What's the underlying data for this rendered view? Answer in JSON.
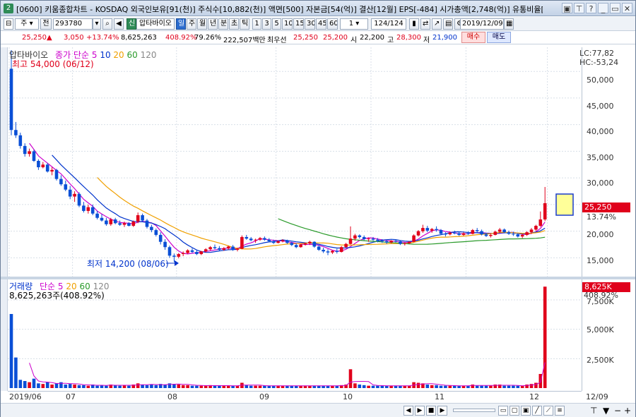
{
  "window": {
    "number": "2",
    "title": "[0600] 키움종합차트 - KOSDAQ 외국인보유[91(천)] 주식수[10,882(천)] 액면[500] 자본금[54(억)] 결산[12월] EPS[-484] 시가총액[2,748(억)] 유통비율[64.8"
  },
  "toolbar": {
    "type_select": "주",
    "tab_jeon": "전",
    "code": "293780",
    "shin": "신",
    "stock_name": "압타바이오",
    "periods": [
      "일",
      "주",
      "월",
      "년",
      "분",
      "초",
      "틱"
    ],
    "minutes": [
      "1",
      "3",
      "5",
      "10",
      "15",
      "30",
      "45",
      "60"
    ],
    "count_select": "1",
    "page_count": "124/124",
    "date": "2019/12/09",
    "sell_label": "매수",
    "buy_label": "매도"
  },
  "quote": {
    "price": "25,250",
    "change": "3,050",
    "change_pct": "+13.74%",
    "volume": "8,625,263",
    "vol_ratio": "408.92%",
    "turnover_pct": "79.26%",
    "amount": "222,507백만",
    "best_label": "최우선",
    "ask": "25,250",
    "bid": "25,200",
    "open_label": "시",
    "open": "22,200",
    "high_label": "고",
    "high": "28,300",
    "low_label": "저",
    "low": "21,900"
  },
  "price_panel": {
    "stock_name": "압타바이오",
    "ma_label": "종가 단순",
    "ma_periods": [
      "5",
      "10",
      "20",
      "60",
      "120"
    ],
    "ma_colors": [
      "#cc00cc",
      "#0033cc",
      "#f0a000",
      "#2a9a2a",
      "#888888"
    ],
    "high_note": "최고 54,000 (06/12)",
    "low_note": "최저 14,200 (08/06)",
    "lc": "LC:77,82",
    "hc": "HC:-53,24",
    "current_price": "25,250",
    "current_pct": "13.74%",
    "yticks": [
      "50,000",
      "45,000",
      "40,000",
      "35,000",
      "30,000",
      "25,000",
      "20,000",
      "15,000"
    ]
  },
  "volume_panel": {
    "title": "거래량",
    "ma_label": "단순",
    "ma_periods": [
      "5",
      "20",
      "60",
      "120"
    ],
    "value_note": "8,625,263주(408.92%)",
    "current": "8,625K",
    "current_pct": "408.92%",
    "yticks": [
      "7,500K",
      "5,000K",
      "2,500K"
    ]
  },
  "xaxis": {
    "labels": [
      "2019/06",
      "07",
      "08",
      "09",
      "10",
      "11",
      "12",
      "12/09"
    ]
  },
  "chart_data": {
    "type": "candlestick",
    "price_ylim": [
      12000,
      54000
    ],
    "volume_ylim": [
      0,
      9000
    ],
    "candles": [
      [
        50500,
        54000,
        38000,
        39000
      ],
      [
        39000,
        40500,
        37500,
        38000
      ],
      [
        38000,
        38500,
        35500,
        36000
      ],
      [
        36000,
        36500,
        34000,
        34500
      ],
      [
        34500,
        35500,
        34000,
        35000
      ],
      [
        35000,
        35300,
        33000,
        33200
      ],
      [
        33200,
        33500,
        31500,
        32000
      ],
      [
        32000,
        33000,
        31800,
        32500
      ],
      [
        32500,
        32800,
        31000,
        31200
      ],
      [
        31200,
        32000,
        30500,
        31500
      ],
      [
        31500,
        31700,
        29500,
        29800
      ],
      [
        29800,
        30500,
        28500,
        28800
      ],
      [
        28800,
        29500,
        27500,
        27800
      ],
      [
        27800,
        28500,
        26000,
        26500
      ],
      [
        26500,
        27500,
        25500,
        27000
      ],
      [
        27000,
        27300,
        24500,
        24800
      ],
      [
        24800,
        25500,
        23500,
        23800
      ],
      [
        23800,
        25000,
        23300,
        24500
      ],
      [
        24500,
        25000,
        23000,
        23300
      ],
      [
        23300,
        23800,
        22200,
        22500
      ],
      [
        22500,
        23200,
        21800,
        22000
      ],
      [
        22000,
        22500,
        21000,
        21300
      ],
      [
        21300,
        22500,
        21000,
        22200
      ],
      [
        22200,
        22500,
        21300,
        21500
      ],
      [
        21500,
        22000,
        21000,
        21200
      ],
      [
        21200,
        21800,
        20800,
        21500
      ],
      [
        21500,
        21700,
        20900,
        21000
      ],
      [
        21000,
        22000,
        20800,
        21800
      ],
      [
        21800,
        23500,
        21500,
        23000
      ],
      [
        23000,
        23300,
        21800,
        22000
      ],
      [
        22000,
        22300,
        20500,
        20800
      ],
      [
        20800,
        21200,
        19800,
        20200
      ],
      [
        20200,
        20500,
        19000,
        19300
      ],
      [
        19300,
        19800,
        17500,
        18000
      ],
      [
        18000,
        18500,
        16500,
        17000
      ],
      [
        17000,
        17300,
        15000,
        15400
      ],
      [
        15400,
        15800,
        14200,
        15200
      ],
      [
        15200,
        15900,
        14900,
        15700
      ],
      [
        15700,
        16200,
        15300,
        15900
      ],
      [
        15900,
        16600,
        15700,
        16400
      ],
      [
        16400,
        16800,
        15900,
        16100
      ],
      [
        16100,
        16500,
        15500,
        15700
      ],
      [
        15700,
        16300,
        15500,
        16200
      ],
      [
        16200,
        16800,
        16000,
        16600
      ],
      [
        16600,
        17200,
        16400,
        17000
      ],
      [
        17000,
        17500,
        16600,
        16800
      ],
      [
        16800,
        17200,
        16300,
        16500
      ],
      [
        16500,
        17000,
        16300,
        16800
      ],
      [
        16800,
        17300,
        16500,
        17100
      ],
      [
        17100,
        17400,
        16300,
        16500
      ],
      [
        16500,
        16900,
        16200,
        16700
      ],
      [
        16700,
        19200,
        16600,
        18900
      ],
      [
        18900,
        19300,
        18400,
        18600
      ],
      [
        18600,
        18900,
        18100,
        18300
      ],
      [
        18300,
        18600,
        17800,
        18400
      ],
      [
        18400,
        18900,
        18200,
        18700
      ],
      [
        18700,
        19000,
        18200,
        18400
      ],
      [
        18400,
        18700,
        17900,
        18100
      ],
      [
        18100,
        18400,
        17600,
        17800
      ],
      [
        17800,
        18300,
        17700,
        18100
      ],
      [
        18100,
        18500,
        17900,
        18300
      ],
      [
        18300,
        18400,
        17600,
        17800
      ],
      [
        17800,
        18000,
        17200,
        17400
      ],
      [
        17400,
        17700,
        16800,
        17000
      ],
      [
        17000,
        17600,
        16900,
        17500
      ],
      [
        17500,
        17900,
        17300,
        17700
      ],
      [
        17700,
        18200,
        17400,
        18000
      ],
      [
        18000,
        18100,
        16900,
        17100
      ],
      [
        17100,
        17400,
        16300,
        16500
      ],
      [
        16500,
        16900,
        15900,
        16200
      ],
      [
        16200,
        16600,
        15500,
        16000
      ],
      [
        16000,
        16400,
        15700,
        16300
      ],
      [
        16300,
        16700,
        15800,
        16100
      ],
      [
        16100,
        17200,
        16000,
        17000
      ],
      [
        17000,
        17800,
        16900,
        17600
      ],
      [
        17600,
        20900,
        17500,
        18600
      ],
      [
        18600,
        19500,
        18200,
        19200
      ],
      [
        19200,
        19400,
        18600,
        18900
      ],
      [
        18900,
        19200,
        18300,
        18500
      ],
      [
        18500,
        18800,
        18000,
        18600
      ],
      [
        18600,
        18900,
        18200,
        18400
      ],
      [
        18400,
        18700,
        17900,
        18200
      ],
      [
        18200,
        18500,
        17800,
        18100
      ],
      [
        18100,
        18400,
        17600,
        17900
      ],
      [
        17900,
        18300,
        17700,
        18200
      ],
      [
        18200,
        18500,
        17900,
        18100
      ],
      [
        18100,
        18200,
        17400,
        17600
      ],
      [
        17600,
        17900,
        17300,
        17700
      ],
      [
        17700,
        18100,
        17600,
        18000
      ],
      [
        18000,
        19400,
        17900,
        19200
      ],
      [
        19200,
        20200,
        19000,
        20000
      ],
      [
        20000,
        21200,
        19700,
        20600
      ],
      [
        20600,
        21000,
        19800,
        20100
      ],
      [
        20100,
        20600,
        19700,
        20400
      ],
      [
        20400,
        20900,
        19900,
        20200
      ],
      [
        20200,
        20400,
        19300,
        19500
      ],
      [
        19500,
        19800,
        19000,
        19400
      ],
      [
        19400,
        19900,
        19200,
        19700
      ],
      [
        19700,
        20100,
        19400,
        19600
      ],
      [
        19600,
        19900,
        19100,
        19300
      ],
      [
        19300,
        19800,
        19100,
        19600
      ],
      [
        19600,
        20000,
        19300,
        19500
      ],
      [
        19500,
        20400,
        19400,
        20200
      ],
      [
        20200,
        20600,
        19800,
        20000
      ],
      [
        20000,
        20300,
        19200,
        19400
      ],
      [
        19400,
        19700,
        18900,
        19100
      ],
      [
        19100,
        19500,
        18800,
        19300
      ],
      [
        19300,
        20100,
        19200,
        19900
      ],
      [
        19900,
        20600,
        19700,
        20300
      ],
      [
        20300,
        20500,
        19600,
        19800
      ],
      [
        19800,
        20100,
        19300,
        19500
      ],
      [
        19500,
        19900,
        19100,
        19400
      ],
      [
        19400,
        19600,
        18800,
        19000
      ],
      [
        19000,
        19500,
        18700,
        19300
      ],
      [
        19300,
        20000,
        19100,
        19800
      ],
      [
        19800,
        20600,
        19500,
        20300
      ],
      [
        20300,
        21200,
        20000,
        21000
      ],
      [
        21000,
        23700,
        20800,
        22200
      ],
      [
        22200,
        28300,
        21900,
        25250
      ]
    ],
    "volumes": [
      6300,
      2600,
      700,
      600,
      500,
      800,
      400,
      350,
      500,
      300,
      400,
      500,
      300,
      350,
      300,
      250,
      250,
      200,
      300,
      200,
      250,
      200,
      300,
      250,
      200,
      250,
      200,
      300,
      400,
      300,
      250,
      300,
      250,
      350,
      300,
      400,
      350,
      300,
      250,
      250,
      200,
      200,
      200,
      200,
      250,
      200,
      200,
      200,
      200,
      200,
      200,
      450,
      250,
      200,
      200,
      200,
      200,
      200,
      200,
      200,
      200,
      200,
      200,
      200,
      200,
      200,
      200,
      200,
      200,
      200,
      200,
      200,
      200,
      250,
      300,
      1600,
      400,
      300,
      250,
      200,
      200,
      200,
      200,
      200,
      200,
      200,
      200,
      200,
      200,
      500,
      450,
      400,
      300,
      250,
      250,
      200,
      200,
      200,
      200,
      200,
      200,
      200,
      300,
      200,
      200,
      200,
      200,
      300,
      300,
      200,
      200,
      200,
      200,
      200,
      300,
      350,
      450,
      1200,
      8625
    ],
    "month_starts": {
      "2019/06": 0,
      "07": 14,
      "08": 37,
      "09": 59,
      "10": 80,
      "11": 101,
      "12": 119
    }
  }
}
